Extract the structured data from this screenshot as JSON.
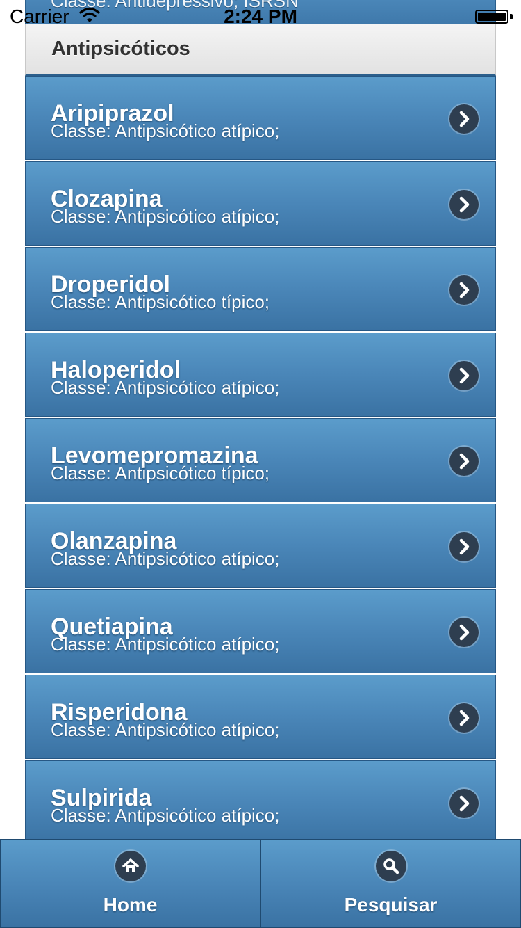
{
  "status_bar": {
    "carrier": "Carrier",
    "time": "2:24 PM"
  },
  "list": {
    "previous_item_partial": "Classe: Antidepressivo; ISRSN",
    "divider": "Antipsicóticos",
    "items": [
      {
        "name": "Aripiprazol",
        "subtitle": "Classe: Antipsicótico atípico;"
      },
      {
        "name": "Clozapina",
        "subtitle": "Classe: Antipsicótico atípico;"
      },
      {
        "name": "Droperidol",
        "subtitle": "Classe: Antipsicótico típico;"
      },
      {
        "name": "Haloperidol",
        "subtitle": "Classe: Antipsicótico atípico;"
      },
      {
        "name": "Levomepromazina",
        "subtitle": "Classe: Antipsicótico típico;"
      },
      {
        "name": "Olanzapina",
        "subtitle": "Classe: Antipsicótico atípico;"
      },
      {
        "name": "Quetiapina",
        "subtitle": "Classe: Antipsicótico atípico;"
      },
      {
        "name": "Risperidona",
        "subtitle": "Classe: Antipsicótico atípico;"
      },
      {
        "name": "Sulpirida",
        "subtitle": "Classe: Antipsicótico atípico;"
      }
    ]
  },
  "tab_bar": {
    "home_label": "Home",
    "home_icon": "home-icon",
    "search_label": "Pesquisar",
    "search_icon": "search-icon"
  },
  "colors": {
    "list_item_top": "#5b9ccb",
    "list_item_bottom": "#3a72a3",
    "divider_bg": "#e8e8e8",
    "icon_circle": "#2e3e50"
  }
}
